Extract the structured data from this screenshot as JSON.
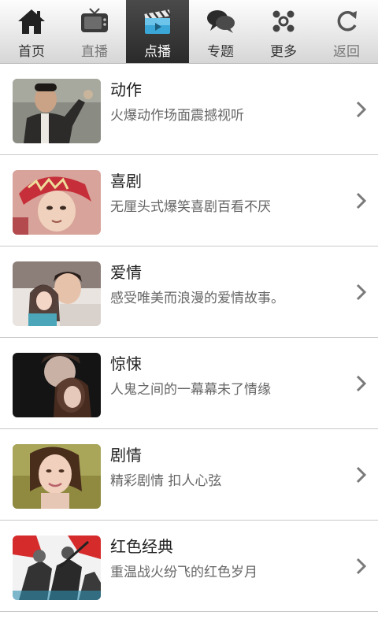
{
  "tabs": [
    {
      "label": "首页",
      "icon": "home-icon"
    },
    {
      "label": "直播",
      "icon": "tv-icon"
    },
    {
      "label": "点播",
      "icon": "clapperboard-icon"
    },
    {
      "label": "专题",
      "icon": "chat-bubbles-icon"
    },
    {
      "label": "更多",
      "icon": "more-icon"
    },
    {
      "label": "返回",
      "icon": "refresh-back-icon"
    }
  ],
  "active_tab": "点播",
  "categories": [
    {
      "title": "动作",
      "desc": "火爆动作场面震撼视听"
    },
    {
      "title": "喜剧",
      "desc": "无厘头式爆笑喜剧百看不厌"
    },
    {
      "title": "爱情",
      "desc": "感受唯美而浪漫的爱情故事。"
    },
    {
      "title": "惊悚",
      "desc": "人鬼之间的一幕幕未了情缘"
    },
    {
      "title": "剧情",
      "desc": "精彩剧情 扣人心弦"
    },
    {
      "title": "红色经典",
      "desc": "重温战火纷飞的红色岁月"
    }
  ],
  "colors": {
    "active_tab_bg": "#333333",
    "active_tab_accent": "#3aa7d8",
    "text_primary": "#222222",
    "text_secondary": "#666666",
    "divider": "#c9c9c9"
  }
}
